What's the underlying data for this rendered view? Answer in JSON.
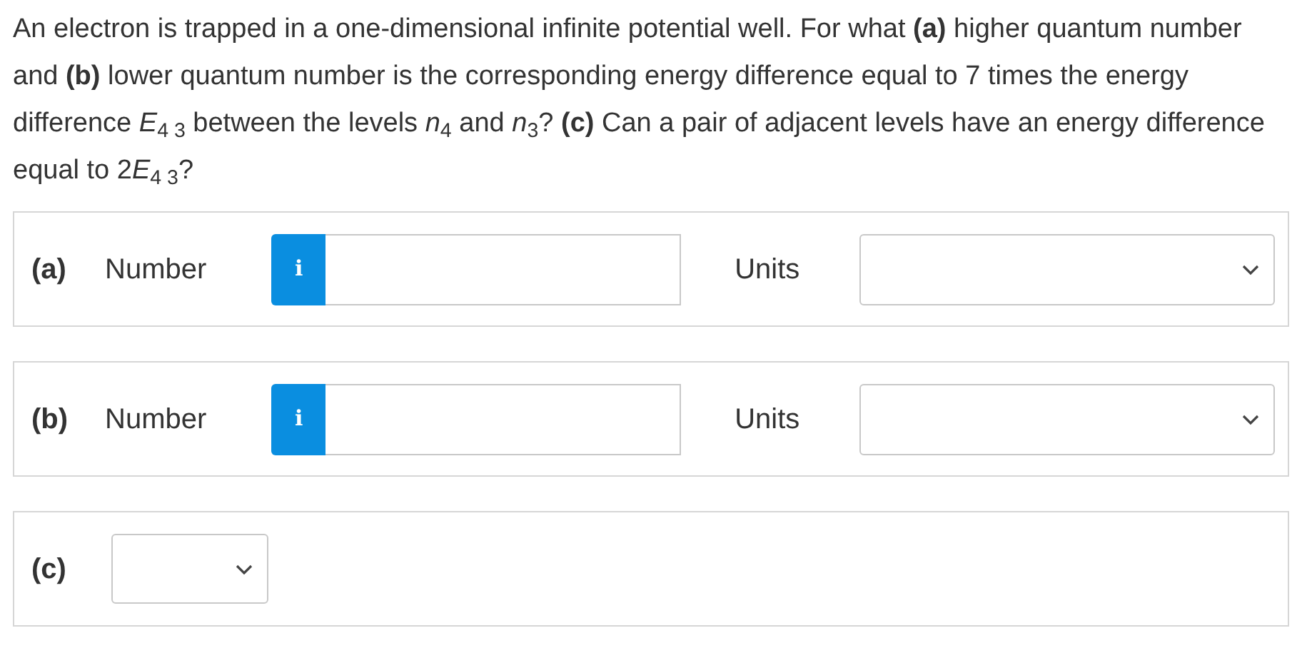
{
  "question": [
    "An electron is trapped in a one-dimensional infinite potential well. For what **(a)** higher quantum number and **(b)** lower quantum number is the corresponding energy difference equal to 7 times the energy difference *E*$_{4 3}$ between the levels *n*$_{4}$ and *n*$_{3}$? **(c)** Can a pair of adjacent levels have an energy difference equal to 2",
    "*E*$_{4 3}$?"
  ],
  "parts": [
    {
      "kind": "number_units",
      "label": "(a)",
      "number_label": "Number",
      "info": "i",
      "units_label": "Units"
    },
    {
      "kind": "number_units",
      "label": "(b)",
      "number_label": "Number",
      "info": "i",
      "units_label": "Units"
    },
    {
      "kind": "dropdown",
      "label": "(c)"
    }
  ]
}
